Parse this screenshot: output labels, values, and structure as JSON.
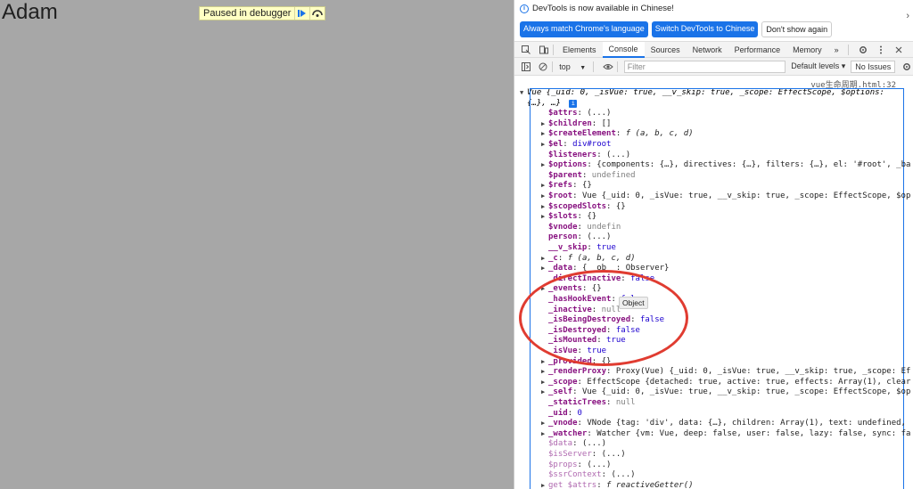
{
  "page": {
    "title": "Adam",
    "paused_label": "Paused in debugger"
  },
  "infobar": {
    "message": "DevTools is now available in Chinese!",
    "btn_match_language": "Always match Chrome's language",
    "btn_switch": "Switch DevTools to Chinese",
    "btn_dont_show": "Don't show again"
  },
  "tabs": [
    "Elements",
    "Console",
    "Sources",
    "Network",
    "Performance",
    "Memory"
  ],
  "tabs_more": "»",
  "toolbar": {
    "context": "top",
    "filter_placeholder": "Filter",
    "levels": "Default levels ▾",
    "issues": "No Issues"
  },
  "console": {
    "source_link": "vue生命周期.html:32",
    "header_line1": "Vue {_uid: 0, _isVue: true, __v_skip: true, _scope: EffectScope, $options:",
    "header_line2": "{…}, …}",
    "tooltip": "Object",
    "rows": [
      {
        "arrow": "",
        "key": "$attrs",
        "val": "(...)",
        "cls": "v",
        "dim": false
      },
      {
        "arrow": "▶",
        "key": "$children",
        "val": "[]",
        "cls": "v",
        "dim": false
      },
      {
        "arrow": "▶",
        "key": "$createElement",
        "val": "f (a, b, c, d)",
        "cls": "v it",
        "dim": false
      },
      {
        "arrow": "▶",
        "key": "$el",
        "val": "div#root",
        "cls": "vn",
        "dim": false
      },
      {
        "arrow": "",
        "key": "$listeners",
        "val": "(...)",
        "cls": "v",
        "dim": false
      },
      {
        "arrow": "▶",
        "key": "$options",
        "val": "{components: {…}, directives: {…}, filters: {…}, el: '#root', _ba",
        "cls": "v",
        "dim": false
      },
      {
        "arrow": "",
        "key": "$parent",
        "val": "undefined",
        "cls": "vg",
        "dim": false
      },
      {
        "arrow": "▶",
        "key": "$refs",
        "val": "{}",
        "cls": "v",
        "dim": false
      },
      {
        "arrow": "▶",
        "key": "$root",
        "val": "Vue {_uid: 0, _isVue: true, __v_skip: true, _scope: EffectScope, $op",
        "cls": "v",
        "dim": false
      },
      {
        "arrow": "▶",
        "key": "$scopedSlots",
        "val": "{}",
        "cls": "v",
        "dim": false
      },
      {
        "arrow": "▶",
        "key": "$slots",
        "val": "{}",
        "cls": "v",
        "dim": false
      },
      {
        "arrow": "",
        "key": "$vnode",
        "val": "undefin",
        "cls": "vg",
        "dim": false
      },
      {
        "arrow": "",
        "key": "person",
        "val": "(...)",
        "cls": "v",
        "dim": false
      },
      {
        "arrow": "",
        "key": "__v_skip",
        "val": "true",
        "cls": "vn",
        "dim": false
      },
      {
        "arrow": "▶",
        "key": "_c",
        "val": "f (a, b, c, d)",
        "cls": "v it",
        "dim": false
      },
      {
        "arrow": "▶",
        "key": "_data",
        "val": "{__ob__: Observer}",
        "cls": "v",
        "dim": false
      },
      {
        "arrow": "",
        "key": "_directInactive",
        "val": "false",
        "cls": "vn",
        "dim": false
      },
      {
        "arrow": "▶",
        "key": "_events",
        "val": "{}",
        "cls": "v",
        "dim": false
      },
      {
        "arrow": "",
        "key": "_hasHookEvent",
        "val": "false",
        "cls": "vn",
        "dim": false
      },
      {
        "arrow": "",
        "key": "_inactive",
        "val": "null",
        "cls": "vg",
        "dim": false
      },
      {
        "arrow": "",
        "key": "_isBeingDestroyed",
        "val": "false",
        "cls": "vn",
        "dim": false
      },
      {
        "arrow": "",
        "key": "_isDestroyed",
        "val": "false",
        "cls": "vn",
        "dim": false
      },
      {
        "arrow": "",
        "key": "_isMounted",
        "val": "true",
        "cls": "vn",
        "dim": false
      },
      {
        "arrow": "",
        "key": "_isVue",
        "val": "true",
        "cls": "vn",
        "dim": false
      },
      {
        "arrow": "▶",
        "key": "_provided",
        "val": "{}",
        "cls": "v",
        "dim": false
      },
      {
        "arrow": "▶",
        "key": "_renderProxy",
        "val": "Proxy(Vue) {_uid: 0, _isVue: true, __v_skip: true, _scope: Ef",
        "cls": "v",
        "dim": false
      },
      {
        "arrow": "▶",
        "key": "_scope",
        "val": "EffectScope {detached: true, active: true, effects: Array(1), clear",
        "cls": "v",
        "dim": false
      },
      {
        "arrow": "▶",
        "key": "_self",
        "val": "Vue {_uid: 0, _isVue: true, __v_skip: true, _scope: EffectScope, $op",
        "cls": "v",
        "dim": false
      },
      {
        "arrow": "",
        "key": "_staticTrees",
        "val": "null",
        "cls": "vg",
        "dim": false
      },
      {
        "arrow": "",
        "key": "_uid",
        "val": "0",
        "cls": "vn",
        "dim": false
      },
      {
        "arrow": "▶",
        "key": "_vnode",
        "val": "VNode {tag: 'div', data: {…}, children: Array(1), text: undefined,",
        "cls": "v",
        "dim": false
      },
      {
        "arrow": "▶",
        "key": "_watcher",
        "val": "Watcher {vm: Vue, deep: false, user: false, lazy: false, sync: fa",
        "cls": "v",
        "dim": false
      },
      {
        "arrow": "",
        "key": "$data",
        "val": "(...)",
        "cls": "v",
        "dim": true
      },
      {
        "arrow": "",
        "key": "$isServer",
        "val": "(...)",
        "cls": "v",
        "dim": true
      },
      {
        "arrow": "",
        "key": "$props",
        "val": "(...)",
        "cls": "v",
        "dim": true
      },
      {
        "arrow": "",
        "key": "$ssrContext",
        "val": "(...)",
        "cls": "v",
        "dim": true
      },
      {
        "arrow": "▶",
        "key": "get $attrs",
        "val": "f reactiveGetter()",
        "cls": "v it",
        "dim": true
      }
    ]
  },
  "colors": {
    "annotation": "#e03c31",
    "accent": "#1a73e8"
  }
}
